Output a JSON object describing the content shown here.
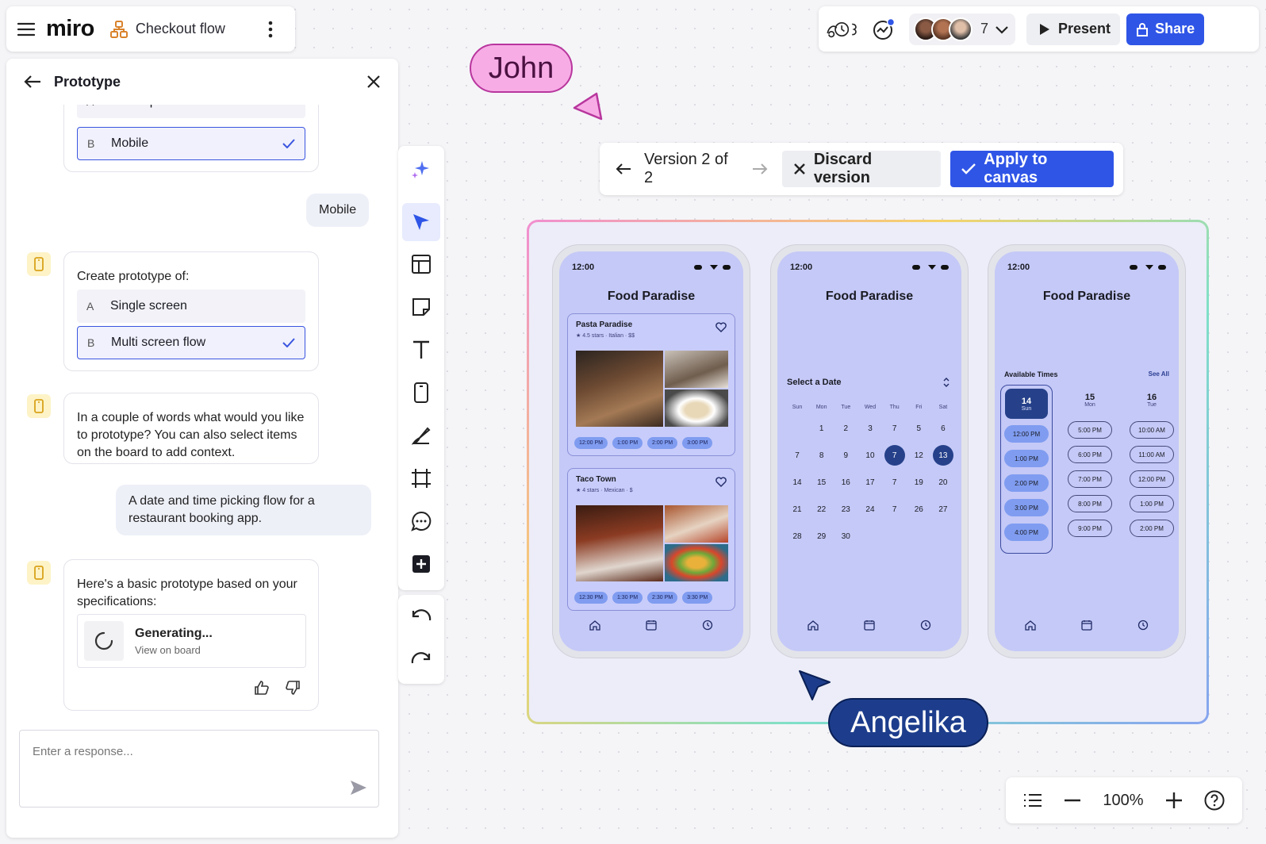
{
  "app": {
    "logo": "miro",
    "board_title": "Checkout flow"
  },
  "header": {
    "collaborator_count": "7",
    "present_label": "Present",
    "share_label": "Share"
  },
  "panel": {
    "title": "Prototype",
    "q1_options": [
      {
        "letter": "A",
        "label": "Desktop"
      },
      {
        "letter": "B",
        "label": "Mobile",
        "selected": true
      }
    ],
    "user_reply_1": "Mobile",
    "q2": {
      "text": "Create prototype of:",
      "options": [
        {
          "letter": "A",
          "label": "Single screen"
        },
        {
          "letter": "B",
          "label": "Multi screen flow",
          "selected": true
        }
      ]
    },
    "q3_text": "In a couple of words what would you like to prototype? You can also select items on the board to add context.",
    "user_reply_2": "A date and time picking flow for a restaurant booking app.",
    "answer_text": "Here's a basic prototype based on your specifications:",
    "generating": {
      "title": "Generating...",
      "link": "View on board"
    },
    "input_placeholder": "Enter a response..."
  },
  "version_bar": {
    "label": "Version 2 of 2",
    "discard_label": "Discard version",
    "apply_label": "Apply to canvas"
  },
  "cursors": {
    "john": "John",
    "angelika": "Angelika"
  },
  "zoom": {
    "level": "100%"
  },
  "phones": {
    "status_time": "12:00",
    "app_title": "Food Paradise",
    "restaurants": [
      {
        "name": "Pasta Paradise",
        "meta": "★ 4.5 stars · Italian · $$",
        "slots": [
          "12:00 PM",
          "1:00 PM",
          "2:00 PM",
          "3:00 PM"
        ]
      },
      {
        "name": "Taco Town",
        "meta": "★ 4 stars · Mexican · $",
        "slots": [
          "12:30 PM",
          "1:30 PM",
          "2:30 PM",
          "3:30 PM"
        ]
      }
    ],
    "calendar": {
      "heading": "Select a Date",
      "weekdays": [
        "Sun",
        "Mon",
        "Tue",
        "Wed",
        "Thu",
        "Fri",
        "Sat"
      ],
      "weeks": [
        [
          "",
          "1",
          "2",
          "3",
          "7",
          "5",
          "6"
        ],
        [
          "7",
          "8",
          "9",
          "10",
          "7",
          "12",
          "13"
        ],
        [
          "14",
          "15",
          "16",
          "17",
          "7",
          "19",
          "20"
        ],
        [
          "21",
          "22",
          "23",
          "24",
          "7",
          "26",
          "27"
        ],
        [
          "28",
          "29",
          "30",
          "",
          "",
          "",
          ""
        ]
      ],
      "highlighted": [
        "7",
        "13"
      ]
    },
    "times": {
      "heading": "Available Times",
      "see_all": "See All",
      "days": [
        {
          "num": "14",
          "dow": "Sun",
          "times": [
            "12:00 PM",
            "1:00 PM",
            "2:00 PM",
            "3:00 PM",
            "4:00 PM"
          ]
        },
        {
          "num": "15",
          "dow": "Mon",
          "times": [
            "5:00 PM",
            "6:00 PM",
            "7:00 PM",
            "8:00 PM",
            "9:00 PM"
          ]
        },
        {
          "num": "16",
          "dow": "Tue",
          "times": [
            "10:00 AM",
            "11:00 AM",
            "12:00 PM",
            "1:00 PM",
            "2:00 PM"
          ]
        }
      ]
    }
  },
  "colors": {
    "accent": "#2f55e7",
    "phone_screen": "#c5c9f7",
    "selected_date": "#26418a",
    "john": "#f7ace6",
    "angelika": "#1d3d8c"
  }
}
